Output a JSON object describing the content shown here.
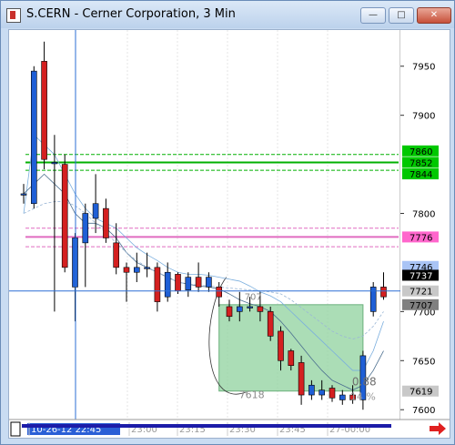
{
  "window": {
    "title": "S.CERN - Cerner Corporation, 3 Min",
    "buttons": {
      "minimize": "—",
      "maximize": "□",
      "close": "✕"
    }
  },
  "chart_data": {
    "type": "candlestick",
    "symbol": "S.CERN",
    "interval": "3 Min",
    "ylim": [
      7590,
      7985
    ],
    "price_ticks": [
      "7950",
      "7900",
      "7800",
      "7700",
      "7650",
      "7600"
    ],
    "price_tags": [
      {
        "label": "7860",
        "price": 7860,
        "color": "#00c800"
      },
      {
        "label": "7852",
        "price": 7852,
        "color": "#00c800"
      },
      {
        "label": "7844",
        "price": 7844,
        "color": "#00c800"
      },
      {
        "label": "7776",
        "price": 7776,
        "color": "#ff66cc"
      },
      {
        "label": "7746",
        "price": 7746,
        "color": "#a9c4f5"
      },
      {
        "label": "7737",
        "price": 7737,
        "color": "#000000"
      },
      {
        "label": "7721",
        "price": 7721,
        "color": "#c8c8c8"
      },
      {
        "label": "7707",
        "price": 7707,
        "color": "#808080"
      },
      {
        "label": "7619",
        "price": 7619,
        "color": "#c8c8c8"
      }
    ],
    "time_labels": [
      "10-26-12 22:45",
      "23:00",
      "23:15",
      "23:30",
      "23:45",
      "27-00:00"
    ],
    "annotations": {
      "zone_low": "7618",
      "zone_right": "0.88",
      "zone_pct": "14 %",
      "zone_top": "707"
    },
    "green_lines": [
      7860,
      7852,
      7844
    ],
    "pink_lines": [
      7785,
      7776,
      7766
    ],
    "crosshair_price": 7721,
    "candles": [
      {
        "o": 7820,
        "h": 7830,
        "l": 7810,
        "c": 7820
      },
      {
        "o": 7810,
        "h": 7950,
        "l": 7805,
        "c": 7945
      },
      {
        "o": 7955,
        "h": 7975,
        "l": 7845,
        "c": 7855
      },
      {
        "o": 7852,
        "h": 7880,
        "l": 7700,
        "c": 7852
      },
      {
        "o": 7850,
        "h": 7860,
        "l": 7740,
        "c": 7745
      },
      {
        "o": 7725,
        "h": 7780,
        "l": 7690,
        "c": 7775
      },
      {
        "o": 7770,
        "h": 7810,
        "l": 7725,
        "c": 7800
      },
      {
        "o": 7795,
        "h": 7840,
        "l": 7780,
        "c": 7810
      },
      {
        "o": 7805,
        "h": 7815,
        "l": 7770,
        "c": 7775
      },
      {
        "o": 7770,
        "h": 7790,
        "l": 7738,
        "c": 7745
      },
      {
        "o": 7745,
        "h": 7750,
        "l": 7710,
        "c": 7740
      },
      {
        "o": 7740,
        "h": 7760,
        "l": 7730,
        "c": 7745
      },
      {
        "o": 7745,
        "h": 7760,
        "l": 7735,
        "c": 7745
      },
      {
        "o": 7745,
        "h": 7750,
        "l": 7700,
        "c": 7710
      },
      {
        "o": 7715,
        "h": 7750,
        "l": 7710,
        "c": 7740
      },
      {
        "o": 7738,
        "h": 7740,
        "l": 7718,
        "c": 7721
      },
      {
        "o": 7722,
        "h": 7740,
        "l": 7715,
        "c": 7735
      },
      {
        "o": 7735,
        "h": 7750,
        "l": 7720,
        "c": 7725
      },
      {
        "o": 7725,
        "h": 7740,
        "l": 7720,
        "c": 7735
      },
      {
        "o": 7725,
        "h": 7730,
        "l": 7705,
        "c": 7715
      },
      {
        "o": 7705,
        "h": 7712,
        "l": 7690,
        "c": 7695
      },
      {
        "o": 7700,
        "h": 7720,
        "l": 7690,
        "c": 7705
      },
      {
        "o": 7705,
        "h": 7715,
        "l": 7700,
        "c": 7705
      },
      {
        "o": 7705,
        "h": 7720,
        "l": 7690,
        "c": 7700
      },
      {
        "o": 7700,
        "h": 7705,
        "l": 7670,
        "c": 7675
      },
      {
        "o": 7680,
        "h": 7685,
        "l": 7640,
        "c": 7650
      },
      {
        "o": 7660,
        "h": 7662,
        "l": 7640,
        "c": 7645
      },
      {
        "o": 7648,
        "h": 7655,
        "l": 7605,
        "c": 7615
      },
      {
        "o": 7615,
        "h": 7630,
        "l": 7610,
        "c": 7625
      },
      {
        "o": 7615,
        "h": 7630,
        "l": 7610,
        "c": 7620
      },
      {
        "o": 7622,
        "h": 7625,
        "l": 7608,
        "c": 7612
      },
      {
        "o": 7610,
        "h": 7620,
        "l": 7605,
        "c": 7615
      },
      {
        "o": 7615,
        "h": 7625,
        "l": 7606,
        "c": 7610
      },
      {
        "o": 7610,
        "h": 7660,
        "l": 7600,
        "c": 7655
      },
      {
        "o": 7700,
        "h": 7730,
        "l": 7695,
        "c": 7725
      },
      {
        "o": 7725,
        "h": 7740,
        "l": 7712,
        "c": 7715
      }
    ],
    "ma_fast": [
      7820,
      7830,
      7840,
      7830,
      7820,
      7800,
      7790,
      7790,
      7785,
      7775,
      7760,
      7750,
      7745,
      7740,
      7735,
      7730,
      7728,
      7726,
      7725,
      7723,
      7718,
      7712,
      7708,
      7705,
      7700,
      7690,
      7678,
      7665,
      7652,
      7640,
      7630,
      7625,
      7620,
      7625,
      7640,
      7660
    ],
    "ma_slow": [
      7800,
      7880,
      7870,
      7860,
      7840,
      7820,
      7805,
      7795,
      7790,
      7785,
      7775,
      7765,
      7758,
      7752,
      7745,
      7740,
      7738,
      7738,
      7737,
      7735,
      7733,
      7731,
      7726,
      7720,
      7716,
      7710,
      7700,
      7690,
      7680,
      7670,
      7660,
      7650,
      7640,
      7640,
      7660,
      7690
    ],
    "ma_dashed": [
      7800,
      7805,
      7810,
      7812,
      7812,
      7808,
      7800,
      7790,
      7780,
      7770,
      7760,
      7752,
      7745,
      7740,
      7735,
      7730,
      7728,
      7727,
      7726,
      7725,
      7724,
      7723,
      7722,
      7721,
      7720,
      7718,
      7712,
      7704,
      7696,
      7688,
      7680,
      7675,
      7672,
      7675,
      7685,
      7700
    ]
  }
}
